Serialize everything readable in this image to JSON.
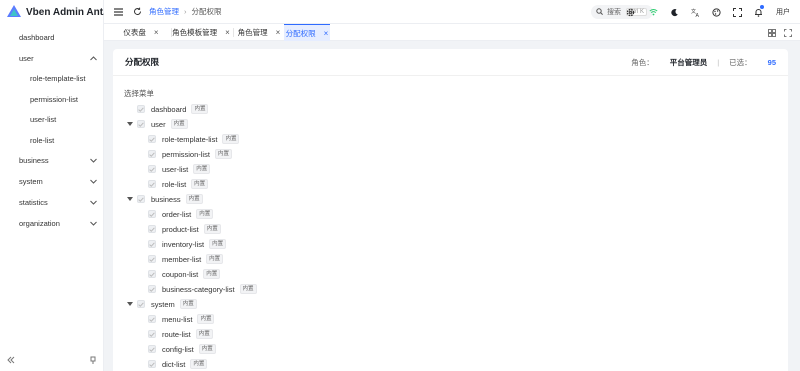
{
  "app": {
    "title": "Vben Admin Ant..."
  },
  "sidebar": {
    "items": [
      {
        "label": "dashboard"
      },
      {
        "label": "user"
      },
      {
        "label": "role-template-list"
      },
      {
        "label": "permission-list"
      },
      {
        "label": "user-list"
      },
      {
        "label": "role-list"
      },
      {
        "label": "business"
      },
      {
        "label": "system"
      },
      {
        "label": "statistics"
      },
      {
        "label": "organization"
      }
    ]
  },
  "header": {
    "breadcrumb_parent": "角色管理",
    "breadcrumb_current": "分配权限",
    "search_label": "搜索",
    "search_shortcut": "Ctrl K",
    "user_name": "用户"
  },
  "tabs": [
    {
      "label": "仪表盘"
    },
    {
      "label": "角色模板管理"
    },
    {
      "label": "角色管理"
    },
    {
      "label": "分配权限"
    }
  ],
  "page": {
    "title": "分配权限",
    "role_label": "角色：",
    "role_value": "平台管理员",
    "selected_label": "已选：",
    "selected_count": "95",
    "section_label": "选择菜单",
    "tag_label": "内置"
  },
  "tree": [
    {
      "label": "dashboard"
    },
    {
      "label": "user"
    },
    {
      "label": "role-template-list"
    },
    {
      "label": "permission-list"
    },
    {
      "label": "user-list"
    },
    {
      "label": "role-list"
    },
    {
      "label": "business"
    },
    {
      "label": "order-list"
    },
    {
      "label": "product-list"
    },
    {
      "label": "inventory-list"
    },
    {
      "label": "member-list"
    },
    {
      "label": "coupon-list"
    },
    {
      "label": "business-category-list"
    },
    {
      "label": "system"
    },
    {
      "label": "menu-list"
    },
    {
      "label": "route-list"
    },
    {
      "label": "config-list"
    },
    {
      "label": "dict-list"
    }
  ],
  "colors": {
    "accent": "#2f6bff",
    "active_tab_bg": "#e6edff"
  }
}
